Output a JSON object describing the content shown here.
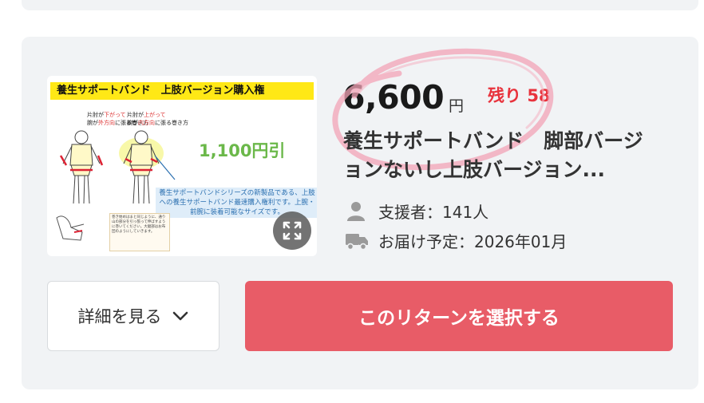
{
  "reward": {
    "price": "6,600",
    "currency": "円",
    "remaining_label": "残り",
    "remaining_count": "58",
    "title": "養生サポートバンド　脚部バージョンないし上肢バージョン...",
    "supporters": "支援者：141人",
    "delivery": "お届け予定：2026年01月"
  },
  "thumbnail": {
    "banner": "養生サポートバンド　上肢バージョン購入権",
    "note_left_1": "片肘が",
    "note_left_1_red": "下がって",
    "note_left_2": "腕が",
    "note_left_2_red": "外方向",
    "note_left_3": "に張る巻き方",
    "note_right_1": "片肘が",
    "note_right_1_red": "上がって",
    "note_right_2": "腕が",
    "note_right_2_red": "内方向",
    "note_right_3": "に張る巻き方",
    "discount": "1,100円引",
    "desc": "養生サポートバンドシリーズの新製品である、上肢への養生サポートバンド最速購入権利です。上腕・前腕に装着可能なサイズです。",
    "small_text": "巻き始めはまと同じように、通り山の部分を引っ張って伸ばすように巻いてください。大腿部はお布団のようにしていきます。"
  },
  "buttons": {
    "details": "詳細を見る",
    "select": "このリターンを選択する"
  },
  "icons": {
    "supporters": "person-icon",
    "delivery": "truck-icon",
    "expand": "expand-icon",
    "chevron": "chevron-down-icon"
  },
  "colors": {
    "accent": "#e85c67",
    "remaining": "#e8323c",
    "card_bg": "#f1f3f5",
    "annotation": "#f2a3b5"
  }
}
